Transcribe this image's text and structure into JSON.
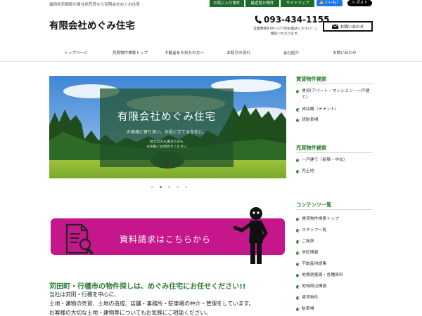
{
  "header": {
    "tagline": "福岡県京都郡の賃住用売買なら有限会社めぐみ住宅",
    "top_links": [
      "お気に入り物件",
      "最近見た物件",
      "サイトマップ"
    ],
    "like_label": "👍 いいね！",
    "post_label": "𝕏 ポスト",
    "site_title": "有限会社めぐみ住宅",
    "phone": "093-434-1155",
    "hours_line1": "営業時間9:00～17:00お電話ください！ご",
    "hours_line2": "相談いただけます。",
    "contact_label": "お問い合わせ"
  },
  "nav": {
    "items": [
      "トップページ",
      "売買物件検索トップ",
      "不動産をお持ちの方へ",
      "お取引の流れ",
      "会社紹介",
      "お問い合わせ"
    ]
  },
  "hero": {
    "title": "有限会社めぐみ住宅",
    "subtitle": "お客様に寄り添い、お役に立てる存在に。",
    "small1": "地元の方も遠方の方も",
    "small2": "お気軽にお問合せください",
    "slide_count": 5,
    "active_slide": 2
  },
  "banner": {
    "text": "資料請求はこちらから"
  },
  "main": {
    "heading": "苅田町・行橋市の物件探しは、めぐみ住宅にお任せください!!",
    "line1": "当社は苅田・行橋を中心に、",
    "line2": "土地・建物の売買、土地の造成、店舗・事務所・駐車場の仲介・管理をしています。",
    "line3": "お客様の大切な土地・建物等についてもお気軽にご相談ください。"
  },
  "sidebar": {
    "sections": [
      {
        "heading": "賃貸物件検索",
        "items": [
          "賃貸(アパート・マンション・一戸建て)",
          "貸店舗（テナント）",
          "貸駐車場"
        ]
      },
      {
        "heading": "売買物件検索",
        "items": [
          "一戸建て（新築・中古）",
          "売土地"
        ]
      },
      {
        "heading": "コンテンツ一覧",
        "items": [
          "賃貸物件検索トップ",
          "スタッフ一覧",
          "ご挨拶",
          "学区情報",
          "不動産用語集",
          "地積測量図・各種資料",
          "地域周辺情報",
          "賃貸物件",
          "駐車場"
        ]
      }
    ]
  },
  "colors": {
    "brand_green": "#2e7d32",
    "toplink_green": "#1f6b2a",
    "banner_magenta": "#c5168b",
    "facebook_blue": "#1877f2"
  }
}
